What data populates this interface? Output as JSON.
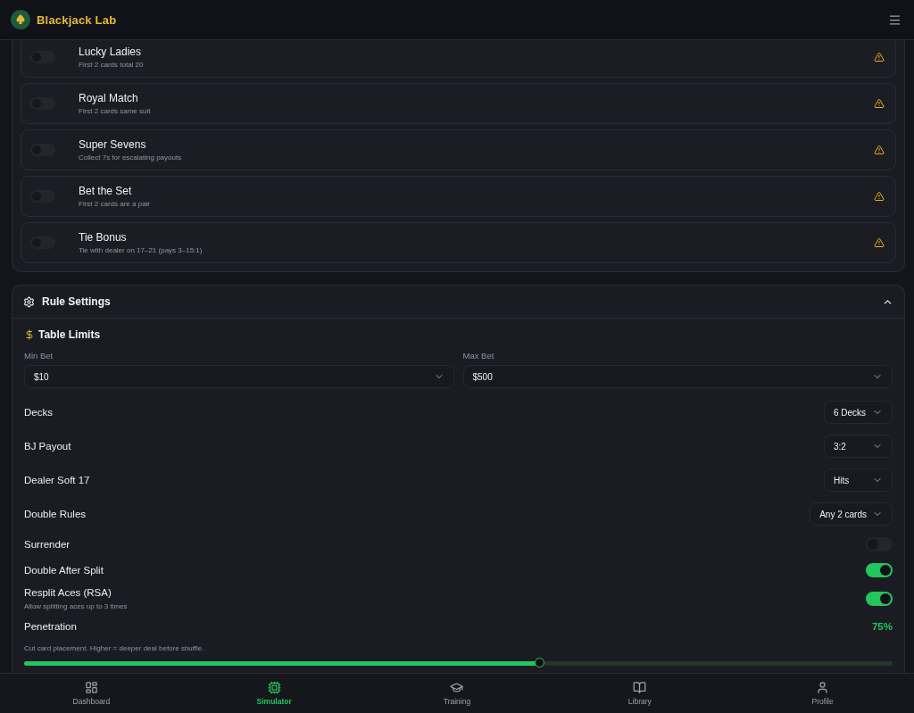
{
  "app": {
    "title": "Blackjack Lab"
  },
  "side_bets": [
    {
      "name": "Lucky Ladies",
      "description": "First 2 cards total 20",
      "on": false
    },
    {
      "name": "Royal Match",
      "description": "First 2 cards same suit",
      "on": false
    },
    {
      "name": "Super Sevens",
      "description": "Collect 7s for escalating payouts",
      "on": false
    },
    {
      "name": "Bet the Set",
      "description": "First 2 cards are a pair",
      "on": false
    },
    {
      "name": "Tie Bonus",
      "description": "Tie with dealer on 17–21 (pays 3–15:1)",
      "on": false
    }
  ],
  "rule_settings": {
    "title": "Rule Settings",
    "expanded": true,
    "table_limits": {
      "title": "Table Limits",
      "fields": [
        {
          "label": "Min Bet",
          "value": "$10"
        },
        {
          "label": "Max Bet",
          "value": "$500"
        }
      ]
    },
    "rules": [
      {
        "kind": "select",
        "label": "Decks",
        "value": "6 Decks"
      },
      {
        "kind": "select",
        "label": "BJ Payout",
        "value": "3:2"
      },
      {
        "kind": "select",
        "label": "Dealer Soft 17",
        "value": "Hits"
      },
      {
        "kind": "select",
        "label": "Double Rules",
        "value": "Any 2 cards"
      },
      {
        "kind": "toggle",
        "label": "Surrender",
        "on": false
      },
      {
        "kind": "toggle",
        "label": "Double After Split",
        "on": true
      },
      {
        "kind": "toggle",
        "label": "Resplit Aces (RSA)",
        "description": "Allow splitting aces up to 3 times",
        "on": true
      },
      {
        "kind": "slider",
        "label": "Penetration",
        "reading": "75%",
        "description": "Cut card placement. Higher = deeper deal before shuffle.",
        "level": 0.594
      }
    ]
  },
  "nav": [
    {
      "label": "Dashboard",
      "selected": false
    },
    {
      "label": "Simulator",
      "selected": true
    },
    {
      "label": "Training",
      "selected": false
    },
    {
      "label": "Library",
      "selected": false
    },
    {
      "label": "Profile",
      "selected": false
    }
  ]
}
